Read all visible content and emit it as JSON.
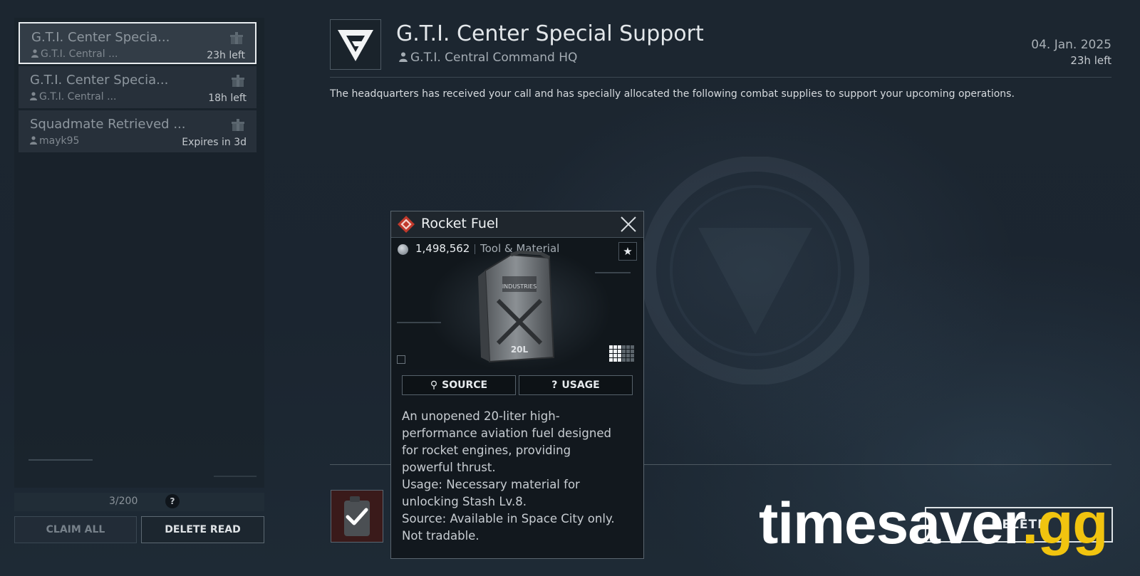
{
  "mail_list": {
    "items": [
      {
        "title": "G.T.I. Center Specia...",
        "sender": "G.T.I. Central ...",
        "time": "23h left",
        "selected": true
      },
      {
        "title": "G.T.I. Center Specia...",
        "sender": "G.T.I. Central ...",
        "time": "18h left",
        "selected": false
      },
      {
        "title": "Squadmate Retrieved ...",
        "sender": "mayk95",
        "time": "Expires in 3d",
        "selected": false
      }
    ],
    "count": "3/200",
    "help": "?",
    "claim_all_label": "CLAIM ALL",
    "delete_read_label": "DELETE READ"
  },
  "detail": {
    "title": "G.T.I. Center Special Support",
    "sender": "G.T.I. Central Command HQ",
    "date": "04. Jan. 2025",
    "time_left": "23h left",
    "body": "The headquarters has received your call and has specially allocated the following combat supplies to support your upcoming operations.",
    "bottom_button_label": "DELETE"
  },
  "tooltip": {
    "title": "Rocket Fuel",
    "value": "1,498,562",
    "category": "Tool & Material",
    "source_label": "SOURCE",
    "usage_label": "USAGE",
    "description": [
      "An unopened 20-liter high-",
      "performance aviation fuel designed",
      "for rocket engines, providing",
      "powerful thrust.",
      "Usage: Necessary material for",
      "unlocking Stash Lv.8.",
      "Source: Available in Space City only.",
      "Not tradable."
    ],
    "item_can_text": "20L",
    "item_brand_text": "INDUSTRIES"
  },
  "watermark": {
    "main": "timesaver",
    "suffix": ".gg"
  },
  "colors": {
    "background": "#1c2630",
    "watermark_accent": "#f1c40f",
    "rarity_red": "#c0392b"
  }
}
